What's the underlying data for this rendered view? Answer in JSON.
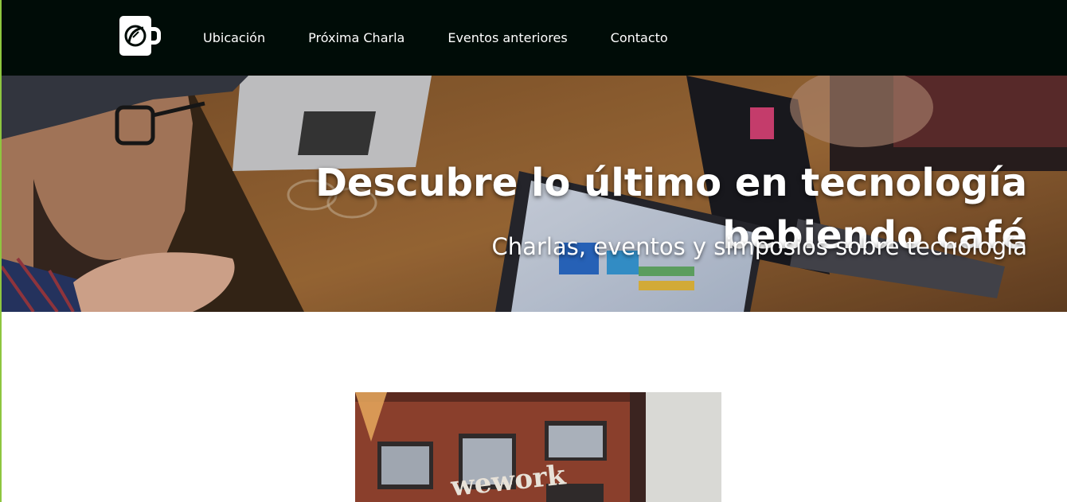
{
  "header": {
    "logo_icon": "coffee-cup-leaf-icon",
    "nav": [
      {
        "label": "Ubicación"
      },
      {
        "label": "Próxima Charla"
      },
      {
        "label": "Eventos anteriores"
      },
      {
        "label": "Contacto"
      }
    ]
  },
  "hero": {
    "title": "Descubre lo último en tecnología bebiendo café",
    "subtitle": "Charlas, eventos y simposios sobre tecnología"
  },
  "featured": {
    "sign_text": "wework"
  },
  "colors": {
    "navbar_bg": "#000c07",
    "accent": "#8ec63f",
    "text_light": "#ffffff"
  }
}
